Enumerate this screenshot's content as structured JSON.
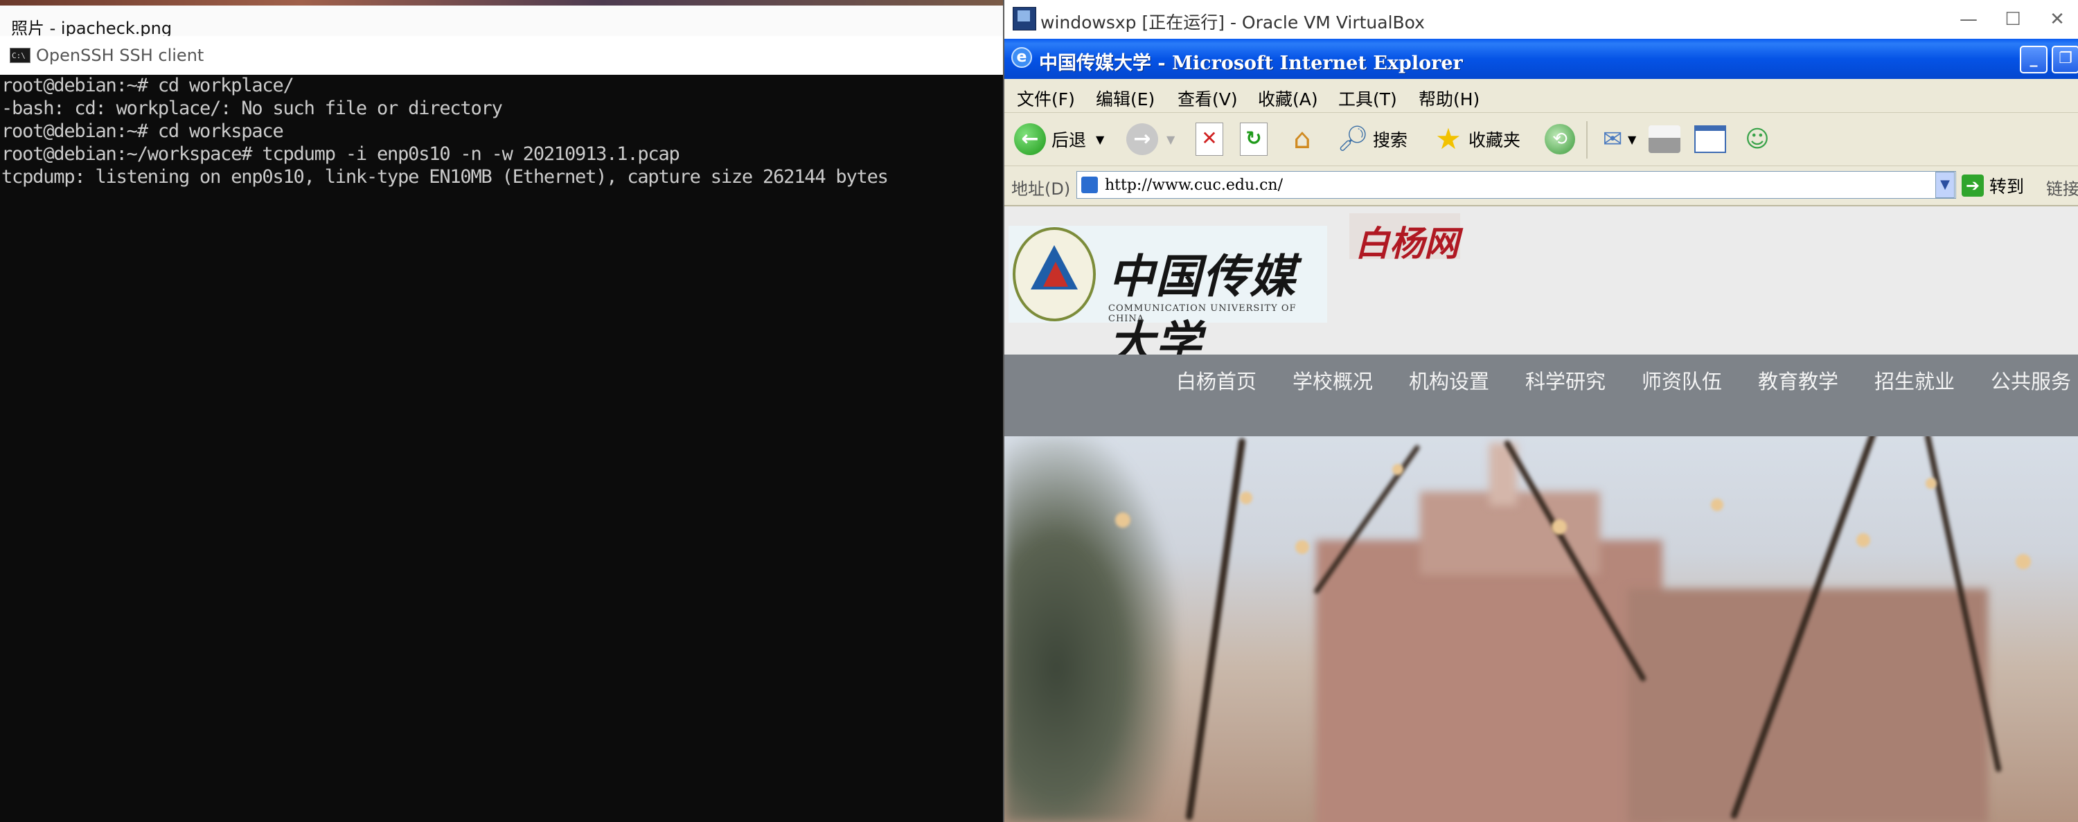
{
  "photos": {
    "title": "照片 - ipacheck.png"
  },
  "ssh": {
    "title": "OpenSSH SSH client",
    "icon_text": "C:\\",
    "lines": [
      "root@debian:~# cd workplace/",
      "-bash: cd: workplace/: No such file or directory",
      "root@debian:~# cd workspace",
      "root@debian:~/workspace# tcpdump -i enp0s10 -n -w 20210913.1.pcap",
      "tcpdump: listening on enp0s10, link-type EN10MB (Ethernet), capture size 262144 bytes"
    ]
  },
  "vbox": {
    "title": "windowsxp [正在运行] - Oracle VM VirtualBox",
    "minimize": "—",
    "maximize": "☐",
    "close": "✕"
  },
  "ie": {
    "title": "中国传媒大学 - Microsoft Internet Explorer",
    "menu": [
      "文件(F)",
      "编辑(E)",
      "查看(V)",
      "收藏(A)",
      "工具(T)",
      "帮助(H)"
    ],
    "toolbar": {
      "back": "后退",
      "search": "搜索",
      "favorites": "收藏夹"
    },
    "address_label": "地址(D)",
    "url": "http://www.cuc.edu.cn/",
    "go": "转到",
    "links": "链接"
  },
  "site": {
    "logo_cn": "中国传媒大学",
    "logo_en": "COMMUNICATION UNIVERSITY OF CHINA",
    "baiyang": "白杨网",
    "nav": [
      "白杨首页",
      "学校概况",
      "机构设置",
      "科学研究",
      "师资队伍",
      "教育教学",
      "招生就业",
      "公共服务"
    ]
  }
}
